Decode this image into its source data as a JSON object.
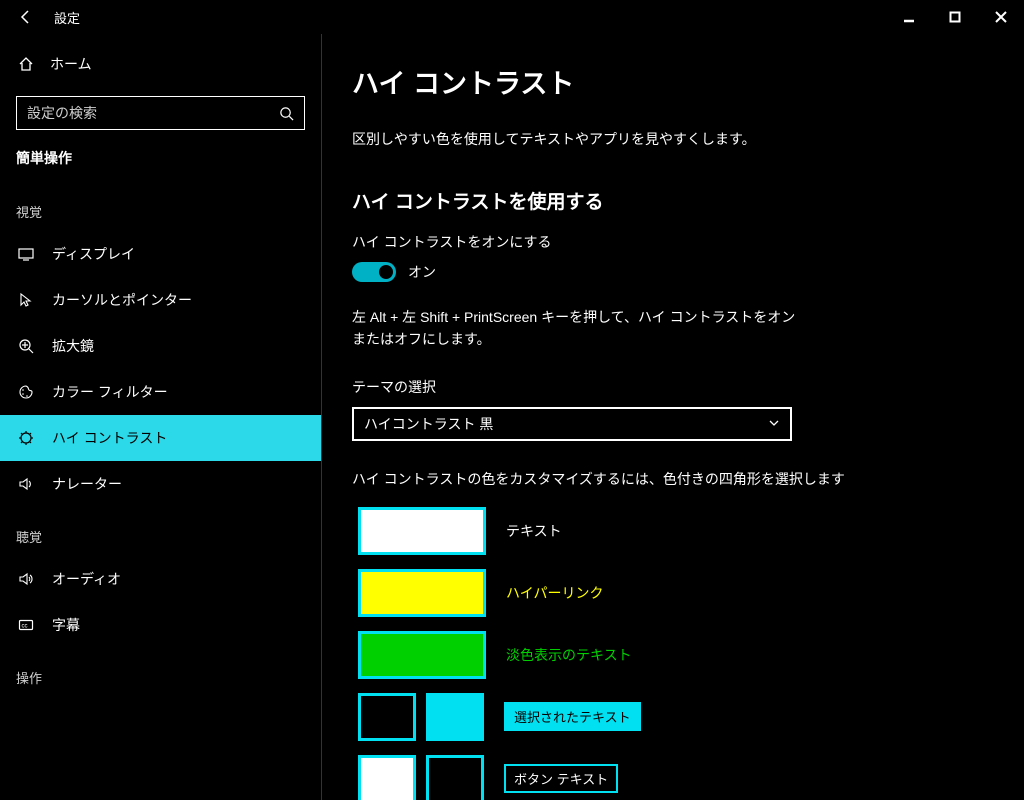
{
  "window": {
    "title": "設定"
  },
  "sidebar": {
    "home_label": "ホーム",
    "search_placeholder": "設定の検索",
    "section": "簡単操作",
    "groups": [
      {
        "title": "視覚",
        "items": [
          {
            "id": "display",
            "label": "ディスプレイ"
          },
          {
            "id": "cursor",
            "label": "カーソルとポインター"
          },
          {
            "id": "magnifier",
            "label": "拡大鏡"
          },
          {
            "id": "color-filter",
            "label": "カラー フィルター"
          },
          {
            "id": "high-contrast",
            "label": "ハイ コントラスト",
            "selected": true
          },
          {
            "id": "narrator",
            "label": "ナレーター"
          }
        ]
      },
      {
        "title": "聴覚",
        "items": [
          {
            "id": "audio",
            "label": "オーディオ"
          },
          {
            "id": "caption",
            "label": "字幕"
          }
        ]
      },
      {
        "title": "操作",
        "items": []
      }
    ]
  },
  "main": {
    "heading": "ハイ コントラスト",
    "description": "区別しやすい色を使用してテキストやアプリを見やすくします。",
    "use_heading": "ハイ コントラストを使用する",
    "toggle_label": "ハイ コントラストをオンにする",
    "toggle_state": "オン",
    "shortcut_hint": "左 Alt + 左 Shift + PrintScreen キーを押して、ハイ コントラストをオンまたはオフにします。",
    "theme_label": "テーマの選択",
    "theme_value": "ハイコントラスト 黒",
    "customize_hint": "ハイ コントラストの色をカスタマイズするには、色付きの四角形を選択します",
    "swatches": {
      "text": {
        "label": "テキスト",
        "color": "#ffffff",
        "text_color": "#ffffff"
      },
      "hyperlink": {
        "label": "ハイパーリンク",
        "color": "#ffff00",
        "text_color": "#ffff00"
      },
      "disabled": {
        "label": "淡色表示のテキスト",
        "color": "#00d000",
        "text_color": "#00d000"
      },
      "selected": {
        "label": "選択されたテキスト",
        "fg": "#000000",
        "bg": "#00e0f0",
        "tag_bg": "#00e0f0",
        "tag_fg": "#000000"
      },
      "button": {
        "label": "ボタン テキスト",
        "fg": "#ffffff",
        "bg": "#000000",
        "tag_bg": "#000000",
        "tag_fg": "#ffffff"
      }
    }
  }
}
